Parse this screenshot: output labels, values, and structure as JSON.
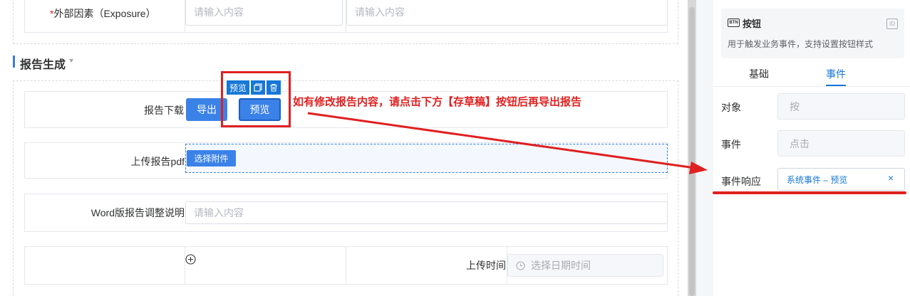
{
  "form": {
    "exposure_label": "外部因素（Exposure）",
    "required_mark": "*",
    "exposure_input1_placeholder": "请输入内容",
    "exposure_input2_placeholder": "请输入内容",
    "section_title": "报告生成",
    "report_download_label": "报告下载",
    "export_button": "导出",
    "preview_button": "预览",
    "toolbar_preview_chip": "预览",
    "upload_pdf_label": "上传报告pdf",
    "select_attachment_button": "选择附件",
    "word_note_label": "Word版报告调整说明",
    "word_note_placeholder": "请输入内容",
    "upload_time_label": "上传时间",
    "datetime_placeholder": "选择日期时间"
  },
  "annotation": {
    "text": "如有修改报告内容，请点击下方【存草稿】按钮后再导出报告",
    "color": "#e02020"
  },
  "panel": {
    "component_badge": "BTN",
    "component_name": "按钮",
    "component_desc": "用于触发业务事件，支持设置按钮样式",
    "id_badge": "ID",
    "tabs": [
      {
        "label": "基础",
        "active": false
      },
      {
        "label": "事件",
        "active": true
      }
    ],
    "object_label": "对象",
    "object_value": "按",
    "event_label": "事件",
    "event_value": "点击",
    "response_label": "事件响应",
    "response_value": "系统事件 – 预览",
    "remove_glyph": "×"
  },
  "colors": {
    "accent": "#1677d6",
    "button_blue": "#3b82e8",
    "annotation_red": "#e02020"
  }
}
